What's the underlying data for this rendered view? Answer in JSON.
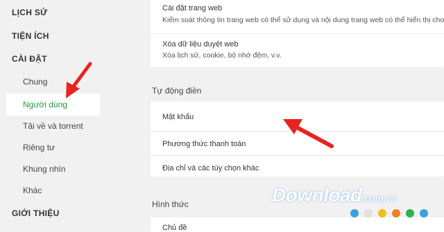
{
  "sidebar": {
    "sections": {
      "history": "LỊCH SỬ",
      "extensions": "TIỆN ÍCH",
      "settings": "CÀI ĐẶT",
      "about": "GIỚI THIỆU"
    },
    "items": [
      {
        "label": "Chung"
      },
      {
        "label": "Người dùng"
      },
      {
        "label": "Tải về và torrent"
      },
      {
        "label": "Riêng tư"
      },
      {
        "label": "Khung nhìn"
      },
      {
        "label": "Khác"
      }
    ]
  },
  "main": {
    "privacy_rows": [
      {
        "title": "Cài đặt trang web",
        "subtitle": "Kiểm soát thông tin trang web có thể sử dụng và nội dung trang web có thể hiển thị cho"
      },
      {
        "title": "Xóa dữ liệu duyệt web",
        "subtitle": "Xóa lịch sử, cookie, bộ nhớ đệm, v.v."
      }
    ],
    "autofill_title": "Tự động điền",
    "autofill_rows": [
      {
        "title": "Mật khẩu"
      },
      {
        "title": "Phương thức thanh toán"
      },
      {
        "title": "Địa chỉ và các tùy chọn khác"
      }
    ],
    "appearance_title": "Hình thức",
    "appearance_rows": [
      {
        "title": "Chủ đề"
      }
    ]
  },
  "watermark": {
    "text": "Download",
    "domain": ".com.vn"
  },
  "colors": {
    "active": "#1a9e3a",
    "arrow": "#e8231f",
    "dots": [
      "#3aa0e0",
      "#e0e0e0",
      "#f0c020",
      "#f08020",
      "#30b050",
      "#3aa0e0"
    ]
  }
}
